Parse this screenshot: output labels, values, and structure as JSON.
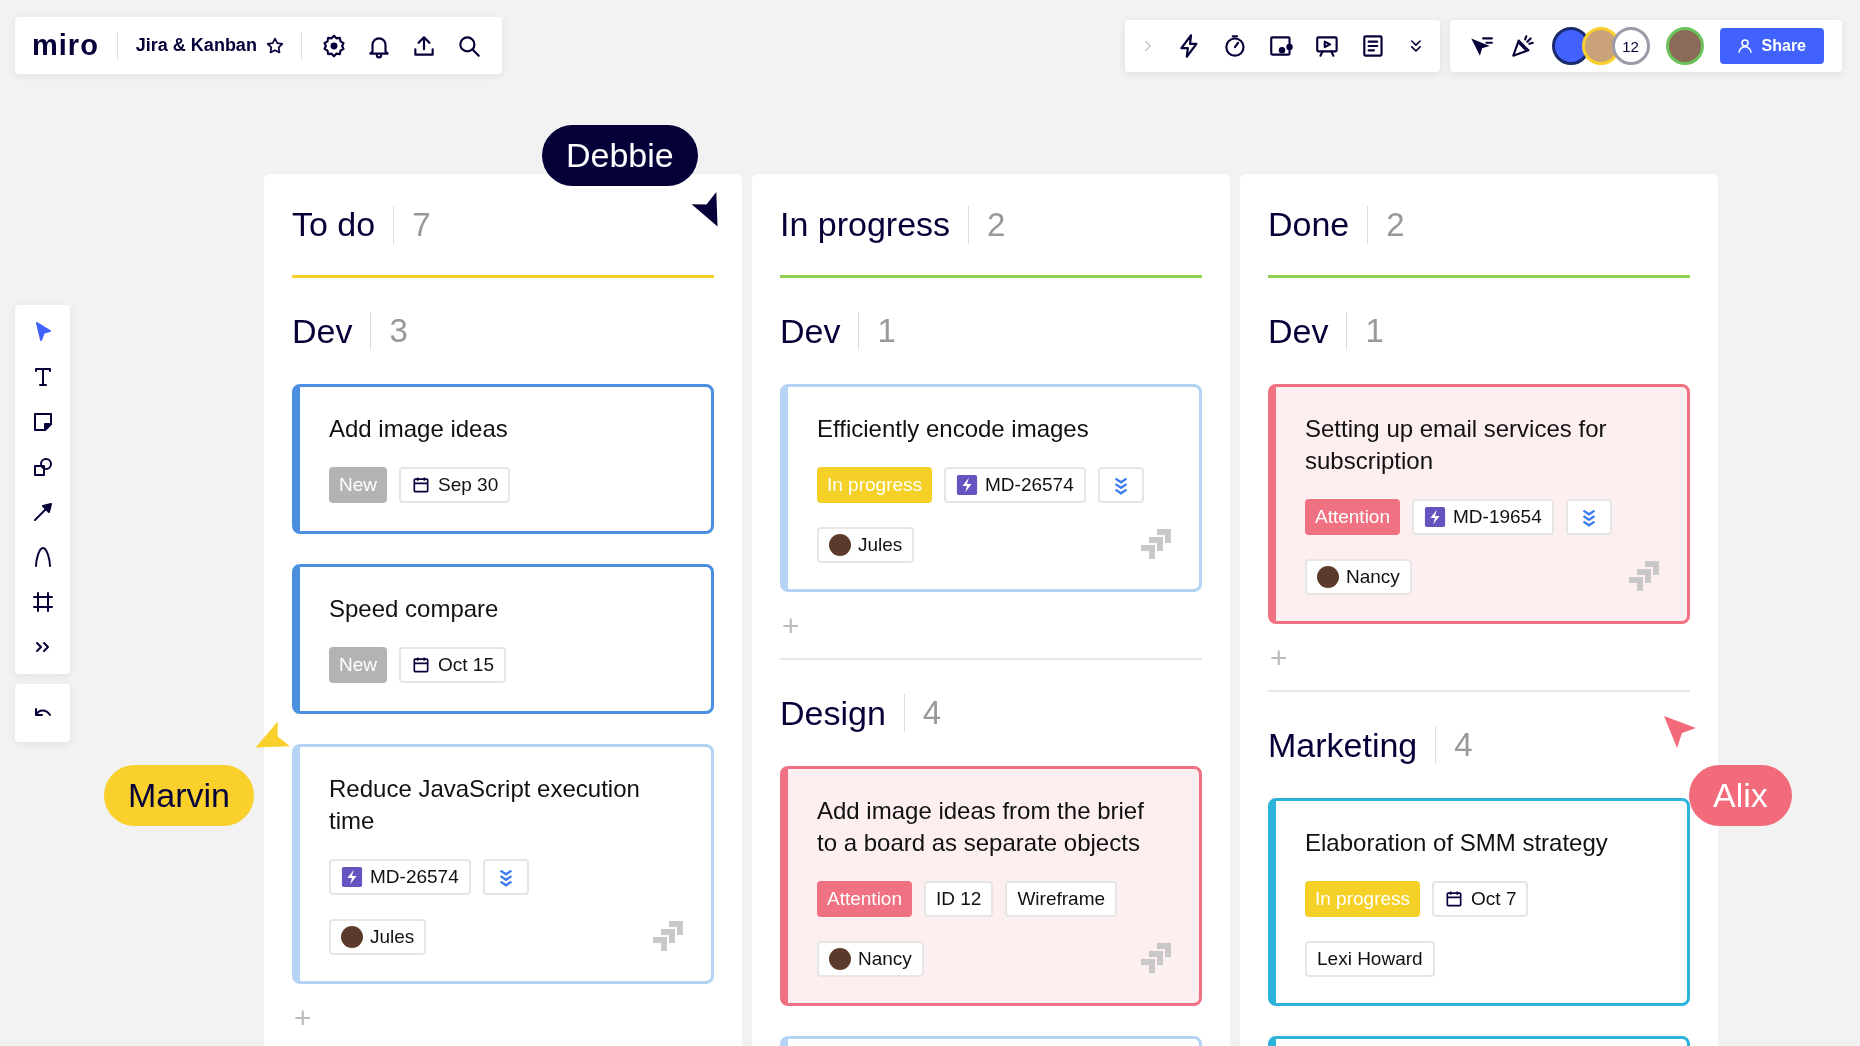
{
  "topbar": {
    "logo": "miro",
    "board_title": "Jira & Kanban",
    "collaborator_count": "12",
    "share_button": "Share"
  },
  "tools": [
    {
      "kind": "select",
      "selected": true
    },
    {
      "kind": "text",
      "selected": false
    },
    {
      "kind": "sticky",
      "selected": false
    },
    {
      "kind": "shapes",
      "selected": false
    },
    {
      "kind": "arrow",
      "selected": false
    },
    {
      "kind": "pen",
      "selected": false
    },
    {
      "kind": "frame",
      "selected": false
    },
    {
      "kind": "more",
      "selected": false
    }
  ],
  "cursors": [
    {
      "name": "Debbie",
      "color": "#050038"
    },
    {
      "name": "Marvin",
      "color": "#fad02c"
    },
    {
      "name": "Alix",
      "color": "#f26b7a"
    }
  ],
  "columns": [
    {
      "title": "To do",
      "count": "7",
      "color": "#f5d128",
      "groups": [
        {
          "title": "Dev",
          "count": "3",
          "add": "+",
          "cards": [
            {
              "title": "Add image ideas",
              "color": "#4a8fe0",
              "tinted": false,
              "jira_linked": false,
              "tags": [
                {
                  "kind": "status",
                  "text": "New",
                  "color": "#b3b3b3"
                },
                {
                  "kind": "date",
                  "text": "Sep 30"
                }
              ]
            },
            {
              "title": "Speed compare",
              "color": "#4a8fe0",
              "tinted": false,
              "jira_linked": false,
              "tags": [
                {
                  "kind": "status",
                  "text": "New",
                  "color": "#b3b3b3"
                },
                {
                  "kind": "date",
                  "text": "Oct 15"
                }
              ]
            },
            {
              "title": "Reduce JavaScript execution time",
              "color": "#b5d3f5",
              "tinted": false,
              "jira_linked": true,
              "tags": [
                {
                  "kind": "issue",
                  "text": "MD-26574"
                },
                {
                  "kind": "priority"
                },
                {
                  "kind": "break"
                },
                {
                  "kind": "person",
                  "text": "Jules"
                }
              ]
            }
          ]
        }
      ]
    },
    {
      "title": "In progress",
      "count": "2",
      "color": "#8fd14f",
      "groups": [
        {
          "title": "Dev",
          "count": "1",
          "add": "+",
          "cards": [
            {
              "title": "Efficiently encode images",
              "color": "#b5d3f5",
              "tinted": false,
              "jira_linked": true,
              "tags": [
                {
                  "kind": "status",
                  "text": "In progress",
                  "color": "#f5d128"
                },
                {
                  "kind": "issue",
                  "text": "MD-26574"
                },
                {
                  "kind": "priority"
                },
                {
                  "kind": "break"
                },
                {
                  "kind": "person",
                  "text": "Jules"
                }
              ]
            }
          ]
        },
        {
          "title": "Design",
          "count": "4",
          "cards": [
            {
              "title": "Add image ideas from the brief to a board as separate objects",
              "color": "#ef7183",
              "tinted": true,
              "jira_linked": true,
              "tags": [
                {
                  "kind": "status",
                  "text": "Attention",
                  "color": "#f07282"
                },
                {
                  "kind": "label",
                  "text": "ID 12"
                },
                {
                  "kind": "label",
                  "text": "Wireframe"
                },
                {
                  "kind": "break"
                },
                {
                  "kind": "person",
                  "text": "Nancy"
                }
              ]
            },
            {
              "color": "#b5d3f5",
              "tinted": false
            }
          ]
        }
      ]
    },
    {
      "title": "Done",
      "count": "2",
      "color": "#8fd14f",
      "groups": [
        {
          "title": "Dev",
          "count": "1",
          "add": "+",
          "cards": [
            {
              "title": "Setting up email services for subscription",
              "color": "#ef7183",
              "tinted": true,
              "jira_linked": true,
              "tags": [
                {
                  "kind": "status",
                  "text": "Attention",
                  "color": "#f07282"
                },
                {
                  "kind": "issue",
                  "text": "MD-19654"
                },
                {
                  "kind": "priority"
                },
                {
                  "kind": "break"
                },
                {
                  "kind": "person",
                  "text": "Nancy"
                }
              ]
            }
          ]
        },
        {
          "title": "Marketing",
          "count": "4",
          "cards": [
            {
              "title": "Elaboration of SMM strategy",
              "color": "#2bb3d9",
              "tinted": false,
              "jira_linked": false,
              "tags": [
                {
                  "kind": "status",
                  "text": "In progress",
                  "color": "#f5d128"
                },
                {
                  "kind": "date",
                  "text": "Oct 7"
                },
                {
                  "kind": "break"
                },
                {
                  "kind": "label",
                  "text": "Lexi Howard"
                }
              ]
            },
            {
              "color": "#2bb3d9",
              "tinted": false
            }
          ]
        }
      ]
    }
  ]
}
